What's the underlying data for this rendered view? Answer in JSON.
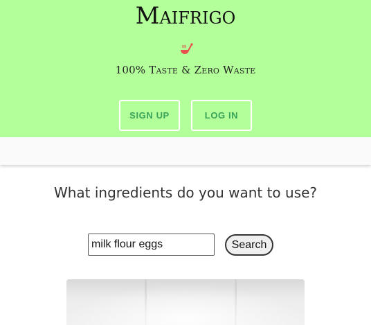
{
  "header": {
    "brand": "Maifrigo",
    "logo_icon": "cooking-utensil-icon",
    "tagline": "100% Taste & Zero Waste",
    "signup_label": "SIGN UP",
    "login_label": "LOG IN",
    "background_color": "#b3ff9a",
    "accent_color": "#3aa35a"
  },
  "search": {
    "question": "What ingredients do you want to use?",
    "value": "milk flour eggs",
    "button_label": "Search"
  }
}
